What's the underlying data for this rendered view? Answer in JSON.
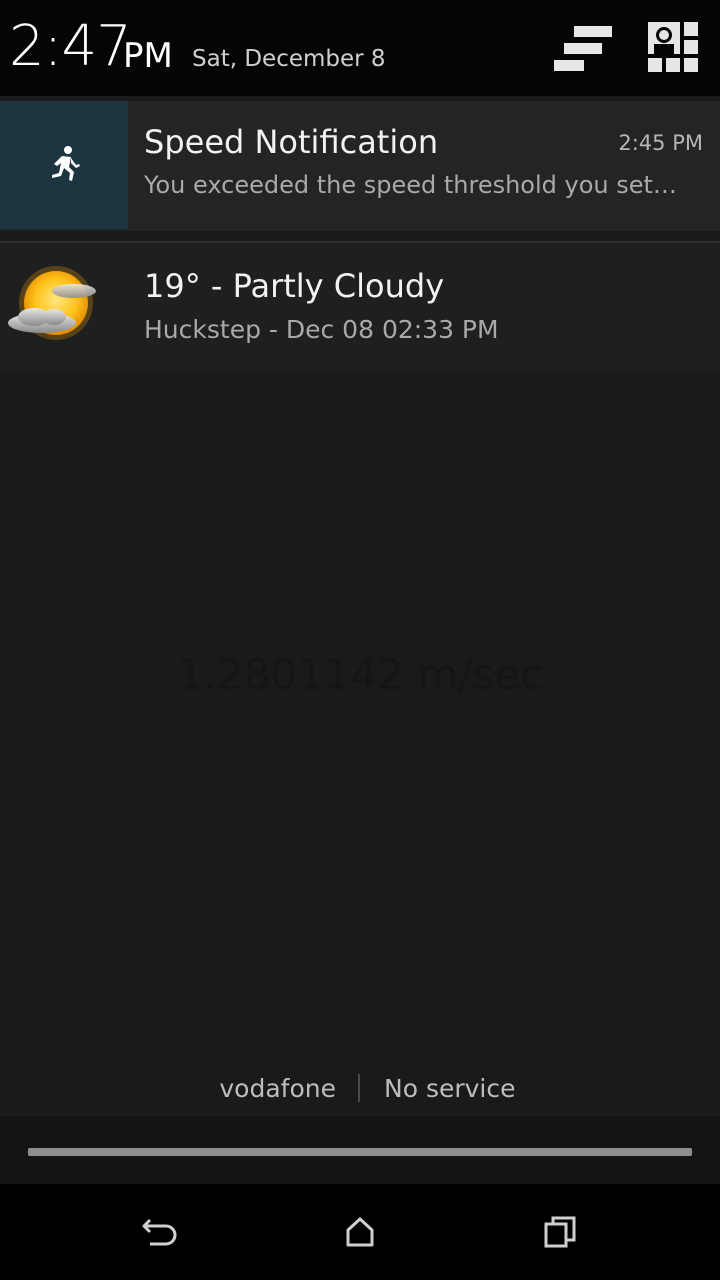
{
  "header": {
    "time": "2:47",
    "ampm": "PM",
    "date": "Sat, December 8",
    "settings_icon": "quick-settings-icon",
    "user_icon": "user-profile-icon"
  },
  "notifications": [
    {
      "title": "Speed Notification",
      "time": "2:45 PM",
      "text": "You exceeded the speed threshold you set…",
      "icon": "running-person-icon",
      "icon_bg": "#1d3540"
    },
    {
      "title": "19° -  Partly Cloudy",
      "text": "Huckstep - Dec 08  02:33 PM",
      "icon": "partly-cloudy-icon"
    }
  ],
  "background_text": "1.2801142 m/sec",
  "carrier": {
    "name": "vodafone",
    "status": "No service"
  },
  "nav": {
    "back": "back-icon",
    "home": "home-icon",
    "recents": "recents-icon"
  }
}
